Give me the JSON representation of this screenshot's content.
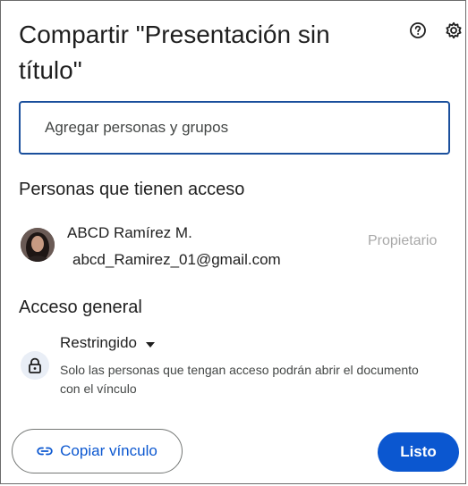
{
  "dialog": {
    "title": "Compartir \"Presentación sin título\"",
    "help_icon": "help-circle-icon",
    "settings_icon": "gear-icon"
  },
  "add_people": {
    "placeholder": "Agregar personas y grupos"
  },
  "people_section": {
    "heading": "Personas que tienen acceso",
    "people": [
      {
        "name": "ABCD Ramírez M.",
        "email": "abcd_Ramirez_01@gmail.com",
        "role": "Propietario"
      }
    ]
  },
  "general_access": {
    "heading": "Acceso general",
    "selected": "Restringido",
    "description": "Solo las personas que tengan acceso podrán abrir el documento con el vínculo",
    "icon": "lock-icon"
  },
  "footer": {
    "copy_link_label": "Copiar vínculo",
    "done_label": "Listo"
  },
  "colors": {
    "accent": "#0b57d0",
    "input_border": "#1a4f9c"
  }
}
